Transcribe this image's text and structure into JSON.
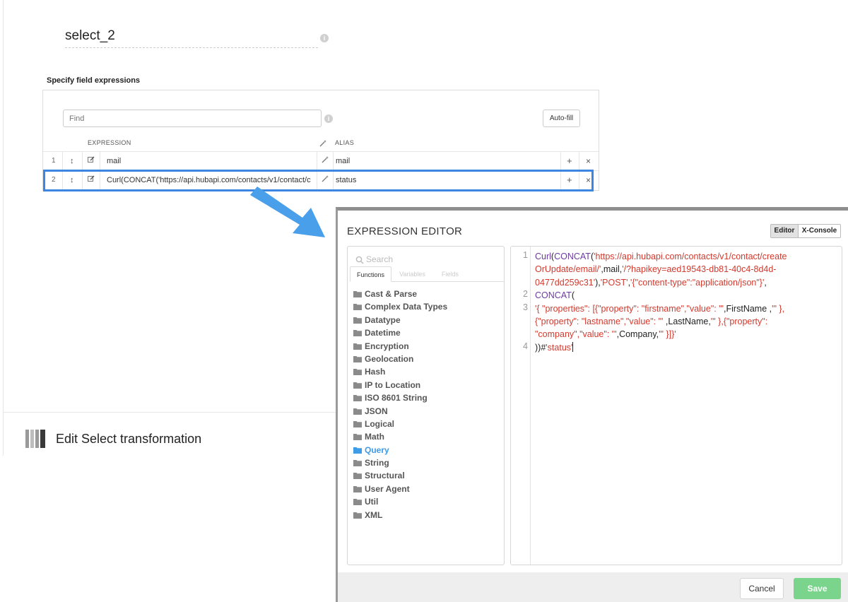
{
  "transformation": {
    "name": "select_2",
    "name_info": "i"
  },
  "field_expressions": {
    "section_title": "Specify field expressions",
    "find_placeholder": "Find",
    "find_info": "i",
    "autofill_label": "Auto-fill",
    "columns": {
      "expression": "EXPRESSION",
      "alias": "ALIAS"
    },
    "rows": [
      {
        "index": "1",
        "expression": "mail",
        "alias": "mail",
        "add": "+",
        "remove": "×"
      },
      {
        "index": "2",
        "expression": "Curl(CONCAT('https://api.hubapi.com/contacts/v1/contact/c",
        "alias": "status",
        "add": "+",
        "remove": "×"
      }
    ]
  },
  "footer_panel": {
    "title": "Edit Select transformation"
  },
  "expression_editor": {
    "title": "EXPRESSION EDITOR",
    "modes": {
      "editor": "Editor",
      "xconsole": "X-Console",
      "active": "Editor"
    },
    "search_placeholder": "Search",
    "tabs": [
      "Functions",
      "Variables",
      "Fields"
    ],
    "active_tab": "Functions",
    "categories": [
      "Cast & Parse",
      "Complex Data Types",
      "Datatype",
      "Datetime",
      "Encryption",
      "Geolocation",
      "Hash",
      "IP to Location",
      "ISO 8601 String",
      "JSON",
      "Logical",
      "Math",
      "Query",
      "String",
      "Structural",
      "User Agent",
      "Util",
      "XML"
    ],
    "selected_category": "Query",
    "code_line_numbers": [
      "1",
      "2",
      "3",
      "4"
    ],
    "code": {
      "l1_fn1": "Curl",
      "l1_p1": "(",
      "l1_fn2": "CONCAT",
      "l1_p2": "(",
      "l1_s1a": "'https://api.hubapi.com/contacts/v1/contact/create",
      "l1_s1b": "OrUpdate/email/'",
      "l1_mail": ",mail,",
      "l1_s2a": "'/?hapikey=aed19543-db81-40c4-8d4d-",
      "l1_s2b": "0477dd259c31'",
      "l1_p3": "),",
      "l1_s3": "'POST'",
      "l1_c1": ",",
      "l1_s4": "'{\"content-type\":\"application/json\"}'",
      "l1_c2": ",",
      "l2_fn": "CONCAT",
      "l2_p": "(",
      "l3_s1": "'{ \"properties\": [{\"property\": \"firstname\",\"value\": \"'",
      "l3_v1": ",FirstName ,",
      "l3_s2a": "'\" },",
      "l3_s2b": "{\"property\": \"lastname\",\"value\": \"'",
      "l3_v2": " ,LastName,",
      "l3_s3a": "'\" },{\"property\":",
      "l3_s3b": "\"company\",\"value\": \"'",
      "l3_v3": ",Company,",
      "l3_s4": "'\" }]}'",
      "l4_p": "))#",
      "l4_s": "'status'"
    },
    "cancel_label": "Cancel",
    "save_label": "Save"
  },
  "colors": {
    "highlight": "#3b86e0",
    "arrow": "#4a9fea",
    "string": "#d23a2e",
    "function": "#6e3aa1",
    "save": "#7ad48b",
    "selected_category": "#3d9be8"
  }
}
